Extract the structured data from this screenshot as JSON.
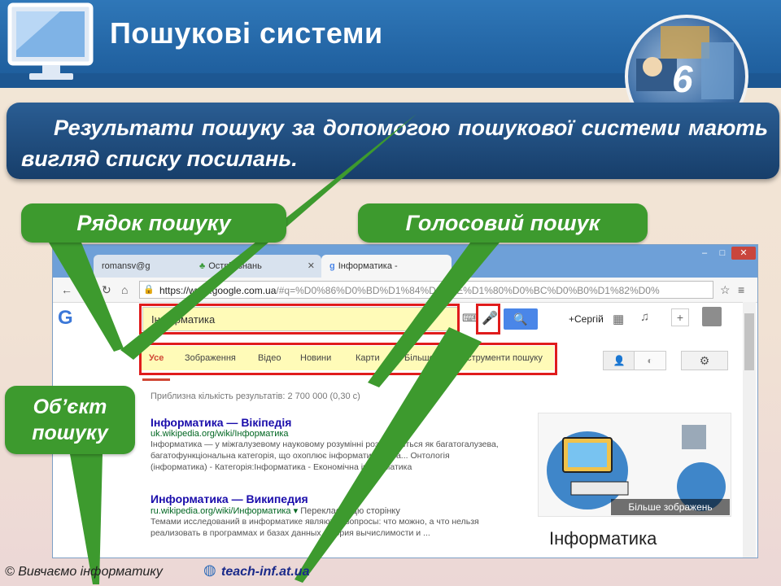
{
  "slide": {
    "title": "Пошукові системи",
    "grade": "6",
    "info_text": "Результати пошуку за допомогою пошукової системи мають вигляд списку посилань.",
    "callouts": {
      "search_row": "Рядок пошуку",
      "voice_search": "Голосовий пошук",
      "search_object": "Об’єкт пошуку"
    },
    "footer_left": "© Вивчаємо інформатику",
    "footer_right": "teach-inf.at.ua"
  },
  "browser": {
    "tabs": [
      {
        "label": "romansv@g"
      },
      {
        "label": "Острів знань"
      },
      {
        "label": "Інформатика -"
      }
    ],
    "address": "https://www.google.com.ua/#q=%D0%86%D0%BD%D1%84%D0%BE%D1%80%D0%BC%D0%B0%D1%82%D0%",
    "address_host": "https://www.google.com.ua",
    "address_rest": "/#q=%D0%86%D0%BD%D1%84%D0%BE%D1%80%D0%BC%D0%B0%D1%82%D0%",
    "search_query": "Інформатика",
    "user_label": "+Сергій",
    "nav": [
      "Усе",
      "Зображення",
      "Відео",
      "Новини",
      "Карти",
      "Більше",
      "Інструменти пошуку"
    ],
    "stats": "Приблизна кількість результатів: 2 700 000 (0,30 с)",
    "results": [
      {
        "title": "Інформатика — Вікіпедія",
        "url": "uk.wikipedia.org/wiki/Інформатика",
        "snippet": "Інформатика — у міжгалузевому науковому розумінні розглядається як багатогалузева, багатофункціональна категорія, що охоплює інформатика вива... Онтологія (інформатика) - Категорія:Інформатика - Економічна інформатика"
      },
      {
        "title": "Информатика — Википедия",
        "url": "ru.wikipedia.org/wiki/Информатика",
        "translate": "Перекласти цю сторінку",
        "snippet": "Темами исследований в информатике являются вопросы: что можно, а что нельзя реализовать в программах и базах данных (теория вычислимости и ..."
      }
    ],
    "more_images": "Більше зображень",
    "kg_title": "Інформатика"
  }
}
